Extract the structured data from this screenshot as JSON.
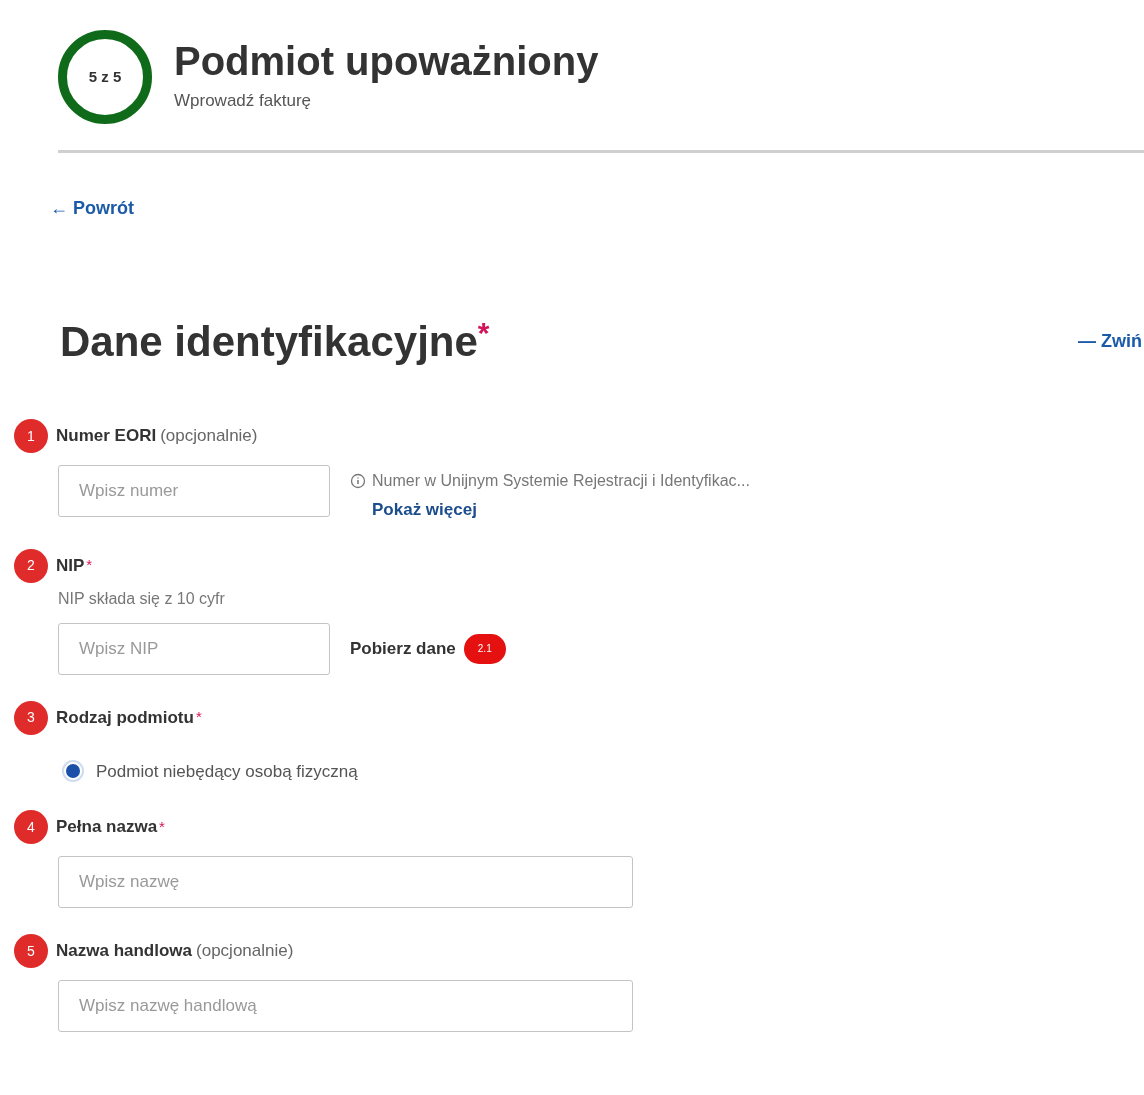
{
  "header": {
    "step": "5 z 5",
    "title": "Podmiot upoważniony",
    "subtitle": "Wprowadź fakturę"
  },
  "back_link": "← Powrót",
  "section": {
    "title": "Dane identyfikacyjne",
    "required_mark": "*",
    "collapse": "— Zwiń"
  },
  "fields": [
    {
      "kind": "input",
      "marker": "1",
      "label": "Numer EORI",
      "optional": "(opcjonalnie)",
      "placeholder": "Wpisz numer",
      "info": "Numer w Unijnym Systemie Rejestracji i Identyfikac...",
      "info_link": "Pokaż więcej",
      "wide": false
    },
    {
      "kind": "input",
      "marker": "2",
      "label": "NIP",
      "required_mark": "*",
      "hint": "NIP składa się z 10 cyfr",
      "placeholder": "Wpisz NIP",
      "action": "Pobierz dane",
      "action_marker": "2.1",
      "wide": false
    },
    {
      "kind": "radio",
      "marker": "3",
      "label": "Rodzaj podmiotu",
      "required_mark": "*",
      "options": [
        {
          "label": "Podmiot niebędący osobą fizyczną",
          "selected": true
        }
      ]
    },
    {
      "kind": "input",
      "marker": "4",
      "label": "Pełna nazwa",
      "required_mark": "*",
      "placeholder": "Wpisz nazwę",
      "wide": true
    },
    {
      "kind": "input",
      "marker": "5",
      "label": "Nazwa handlowa",
      "optional": "(opcjonalnie)",
      "placeholder": "Wpisz nazwę handlową",
      "wide": true
    }
  ]
}
